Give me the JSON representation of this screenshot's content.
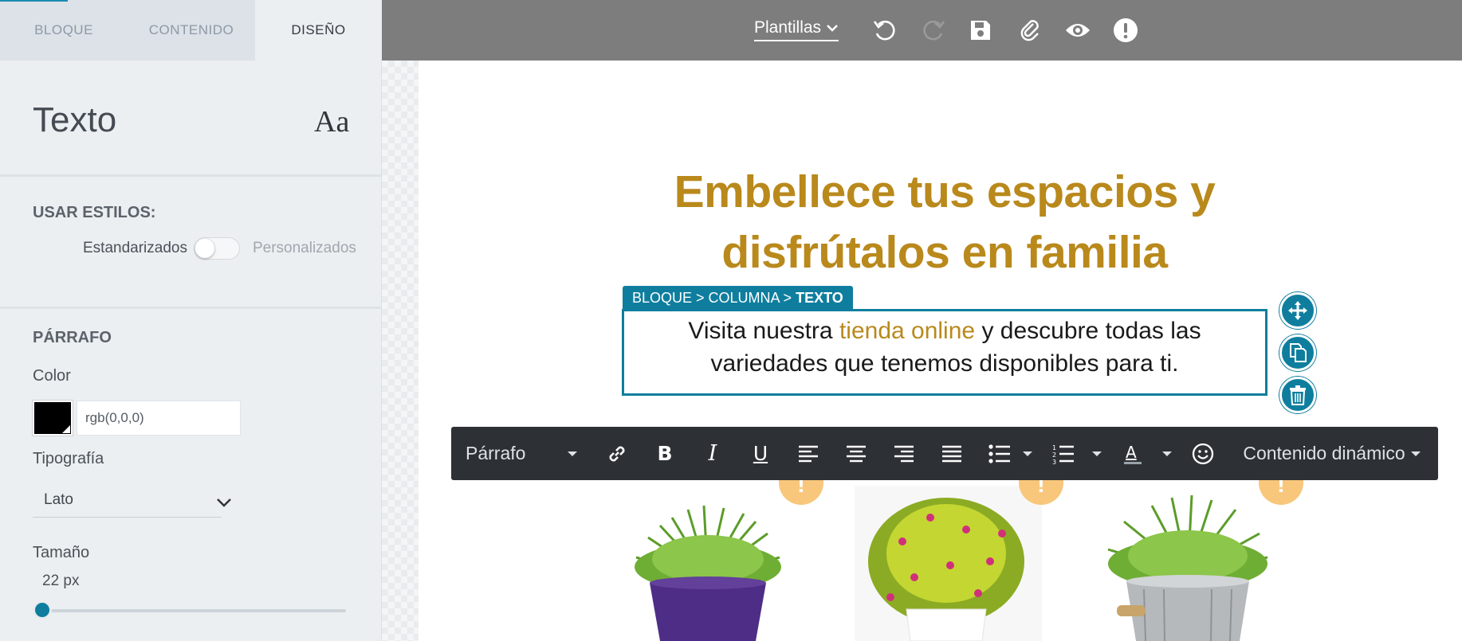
{
  "left_panel": {
    "tabs": [
      {
        "label": "BLOQUE",
        "active": false
      },
      {
        "label": "CONTENIDO",
        "active": false
      },
      {
        "label": "DISEÑO",
        "active": true
      }
    ],
    "section_title": "Texto",
    "section_icon": "Aa",
    "usar_estilos": {
      "label": "USAR ESTILOS:",
      "left_option": "Estandarizados",
      "right_option": "Personalizados",
      "toggle_on": false
    },
    "parrafo": {
      "label": "PÁRRAFO",
      "color_label": "Color",
      "color_value": "rgb(0,0,0)",
      "color_hex": "#000000",
      "tipografia_label": "Tipografía",
      "tipografia_value": "Lato",
      "tamano_label": "Tamaño",
      "tamano_value": "22 px"
    }
  },
  "topbar": {
    "plantillas_label": "Plantillas",
    "icons": [
      "undo-icon",
      "redo-icon",
      "save-icon",
      "attach-icon",
      "preview-icon",
      "alert-icon"
    ]
  },
  "canvas": {
    "headline_line1": "Embellece tus espacios y",
    "headline_line2": "disfrútalos en familia",
    "breadcrumb_prefix": "BLOQUE > COLUMNA > ",
    "breadcrumb_current": "TEXTO",
    "text_before": "Visita nuestra ",
    "text_link": "tienda online",
    "text_after_line1": " y descubre todas las",
    "text_line2": "variedades que tenemos disponibles para ti.",
    "accent_color": "#b9891c",
    "selection_color": "#0f7e9e"
  },
  "editor_toolbar": {
    "paragraph_label": "Párrafo",
    "dynamic_label": "Contenido dinámico",
    "buttons": [
      "link-icon",
      "bold-icon",
      "italic-icon",
      "underline-icon",
      "align-left-icon",
      "align-center-icon",
      "align-right-icon",
      "align-justify-icon",
      "bullet-list-icon",
      "numbered-list-icon",
      "text-color-icon",
      "emoji-icon"
    ]
  },
  "warnings": [
    "!",
    "!",
    "!"
  ]
}
